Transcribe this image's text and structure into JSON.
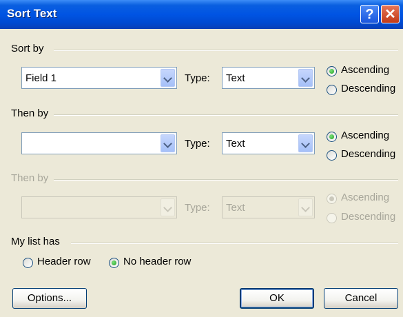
{
  "window": {
    "title": "Sort Text",
    "help_glyph": "?",
    "close_glyph": "✕"
  },
  "sort_by": {
    "group_label": "Sort by",
    "field_value": "Field 1",
    "type_label": "Type:",
    "type_value": "Text",
    "ascending": "Ascending",
    "descending": "Descending",
    "selected": "ascending"
  },
  "then_by_1": {
    "group_label": "Then by",
    "field_value": "",
    "type_label": "Type:",
    "type_value": "Text",
    "ascending": "Ascending",
    "descending": "Descending",
    "selected": "ascending"
  },
  "then_by_2": {
    "group_label": "Then by",
    "field_value": "",
    "type_label": "Type:",
    "type_value": "Text",
    "ascending": "Ascending",
    "descending": "Descending",
    "selected": "ascending",
    "enabled": false
  },
  "my_list_has": {
    "group_label": "My list has",
    "header_row": "Header row",
    "no_header_row": "No header row",
    "selected": "no_header_row"
  },
  "buttons": {
    "options": "Options...",
    "ok": "OK",
    "cancel": "Cancel"
  }
}
